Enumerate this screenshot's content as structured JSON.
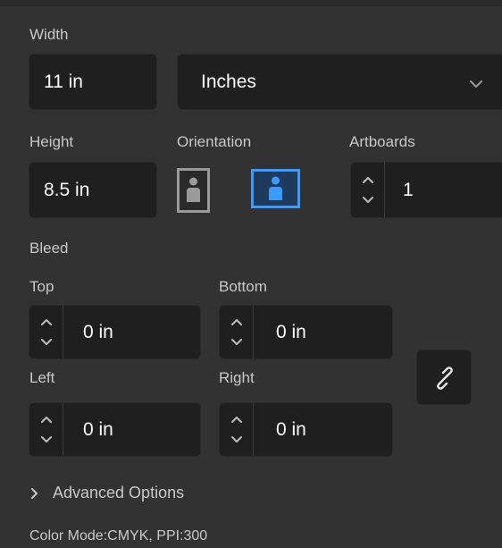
{
  "width": {
    "label": "Width",
    "value": "11 in",
    "unit": "Inches"
  },
  "height": {
    "label": "Height",
    "value": "8.5 in"
  },
  "orientation": {
    "label": "Orientation",
    "selected": "landscape"
  },
  "artboards": {
    "label": "Artboards",
    "value": "1"
  },
  "bleed": {
    "label": "Bleed",
    "top": {
      "label": "Top",
      "value": "0 in"
    },
    "bottom": {
      "label": "Bottom",
      "value": "0 in"
    },
    "left": {
      "label": "Left",
      "value": "0 in"
    },
    "right": {
      "label": "Right",
      "value": "0 in"
    }
  },
  "advanced": {
    "label": "Advanced Options"
  },
  "footer": {
    "color_mode": "Color Mode:CMYK, PPI:300"
  },
  "colors": {
    "accent": "#3d9bff",
    "field_bg": "#1f1f1f",
    "panel_bg": "#323232"
  }
}
